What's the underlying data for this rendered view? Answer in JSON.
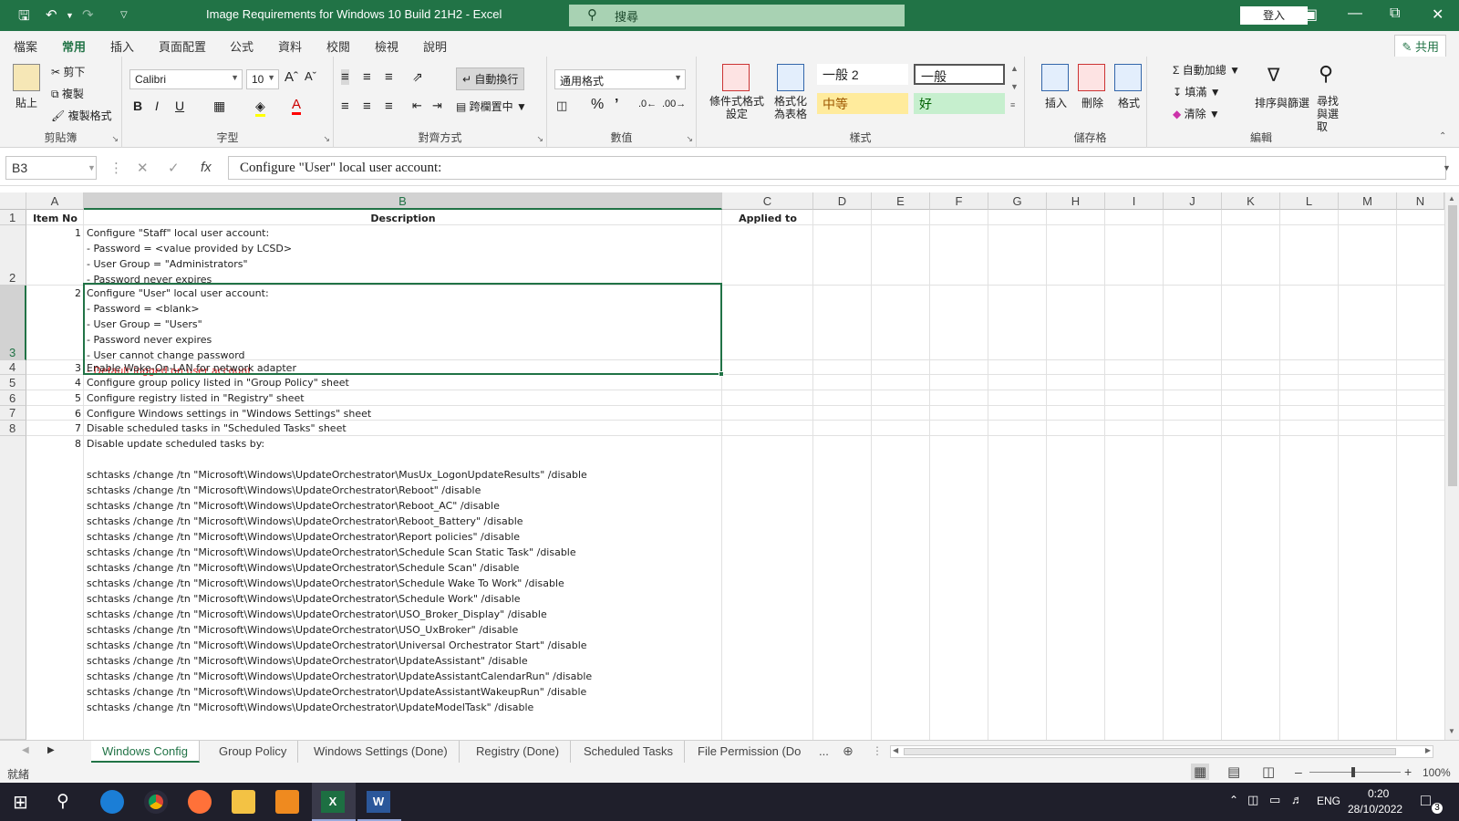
{
  "window": {
    "title": "Image Requirements for Windows 10 Build 21H2  -  Excel",
    "search_placeholder": "搜尋",
    "signin": "登入"
  },
  "menu": {
    "items": [
      "檔案",
      "常用",
      "插入",
      "頁面配置",
      "公式",
      "資料",
      "校閱",
      "檢視",
      "說明"
    ],
    "share": "共用"
  },
  "ribbon": {
    "clipboard": {
      "paste": "貼上",
      "cut": "剪下",
      "copy": "複製",
      "format_painter": "複製格式",
      "label": "剪貼簿"
    },
    "font": {
      "name": "Calibri",
      "size": "10",
      "bold": "B",
      "italic": "I",
      "underline": "U",
      "label": "字型"
    },
    "alignment": {
      "wrap": "自動換行",
      "merge": "跨欄置中",
      "label": "對齊方式"
    },
    "number": {
      "format": "通用格式",
      "label": "數值"
    },
    "styles": {
      "cond": "條件式格式設定",
      "table": "格式化為表格",
      "s1": "一般 2",
      "s2": "一般",
      "s3": "中等",
      "s4": "好",
      "label": "樣式"
    },
    "cells": {
      "insert": "插入",
      "delete": "刪除",
      "format": "格式",
      "label": "儲存格"
    },
    "editing": {
      "autosum": "自動加總",
      "fill": "填滿",
      "clear": "清除",
      "sort": "排序與篩選",
      "find": "尋找與選取",
      "label": "編輯"
    }
  },
  "formula_bar": {
    "namebox": "B3",
    "formula": "Configure \"User\" local user account:"
  },
  "columns": [
    "A",
    "B",
    "C",
    "D",
    "E",
    "F",
    "G",
    "H",
    "I",
    "J",
    "K",
    "L",
    "M",
    "N"
  ],
  "row_numbers": [
    "1",
    "2",
    "3",
    "4",
    "5",
    "6",
    "7",
    "8"
  ],
  "header_row": {
    "a": "Item No",
    "b": "Description",
    "c": "Applied to"
  },
  "rows": [
    {
      "no": "1",
      "lines": [
        "Configure \"Staff\" local user account:",
        "- Password = <value provided by LCSD>",
        "- User Group = \"Administrators\"",
        "- Password never expires"
      ]
    },
    {
      "no": "2",
      "lines": [
        "Configure \"User\" local user account:",
        "- Password = <blank>",
        "- User Group = \"Users\"",
        "- Password never expires",
        "- User cannot change password"
      ],
      "red": "- Default logged on user account"
    },
    {
      "no": "3",
      "lines": [
        "Enable Wake-On-LAN for network adapter"
      ]
    },
    {
      "no": "4",
      "lines": [
        "Configure group policy listed in \"Group Policy\" sheet"
      ]
    },
    {
      "no": "5",
      "lines": [
        "Configure registry listed in \"Registry\" sheet"
      ]
    },
    {
      "no": "6",
      "lines": [
        "Configure Windows settings in \"Windows Settings\" sheet"
      ]
    },
    {
      "no": "7",
      "lines": [
        "Disable scheduled tasks in \"Scheduled Tasks\" sheet"
      ]
    },
    {
      "no": "8",
      "lines": [
        "Disable update scheduled tasks by:",
        "",
        "schtasks /change /tn \"Microsoft\\Windows\\UpdateOrchestrator\\MusUx_LogonUpdateResults\" /disable",
        "schtasks /change /tn \"Microsoft\\Windows\\UpdateOrchestrator\\Reboot\" /disable",
        "schtasks /change /tn \"Microsoft\\Windows\\UpdateOrchestrator\\Reboot_AC\" /disable",
        "schtasks /change /tn \"Microsoft\\Windows\\UpdateOrchestrator\\Reboot_Battery\" /disable",
        "schtasks /change /tn \"Microsoft\\Windows\\UpdateOrchestrator\\Report policies\" /disable",
        "schtasks /change /tn \"Microsoft\\Windows\\UpdateOrchestrator\\Schedule Scan Static Task\" /disable",
        "schtasks /change /tn \"Microsoft\\Windows\\UpdateOrchestrator\\Schedule Scan\" /disable",
        "schtasks /change /tn \"Microsoft\\Windows\\UpdateOrchestrator\\Schedule Wake To Work\" /disable",
        "schtasks /change /tn \"Microsoft\\Windows\\UpdateOrchestrator\\Schedule Work\" /disable",
        "schtasks /change /tn \"Microsoft\\Windows\\UpdateOrchestrator\\USO_Broker_Display\" /disable",
        "schtasks /change /tn \"Microsoft\\Windows\\UpdateOrchestrator\\USO_UxBroker\" /disable",
        "schtasks /change /tn \"Microsoft\\Windows\\UpdateOrchestrator\\Universal Orchestrator Start\" /disable",
        "schtasks /change /tn \"Microsoft\\Windows\\UpdateOrchestrator\\UpdateAssistant\" /disable",
        "schtasks /change /tn \"Microsoft\\Windows\\UpdateOrchestrator\\UpdateAssistantCalendarRun\" /disable",
        "schtasks /change /tn \"Microsoft\\Windows\\UpdateOrchestrator\\UpdateAssistantWakeupRun\" /disable",
        "schtasks /change /tn \"Microsoft\\Windows\\UpdateOrchestrator\\UpdateModelTask\" /disable"
      ]
    }
  ],
  "sheet_tabs": [
    "Windows Config",
    "Group Policy",
    "Windows Settings (Done)",
    "Registry (Done)",
    "Scheduled Tasks",
    "File Permission (Do"
  ],
  "sheet_tabs_more": "...",
  "status": {
    "ready": "就緒",
    "zoom": "100%"
  },
  "taskbar": {
    "lang": "ENG",
    "time": "0:20",
    "date": "28/10/2022",
    "notif_count": "3"
  },
  "colors": {
    "excel_green": "#217346",
    "red_text": "#e02020",
    "style_neutral": "#ffeb9c",
    "style_good": "#c6efce"
  }
}
